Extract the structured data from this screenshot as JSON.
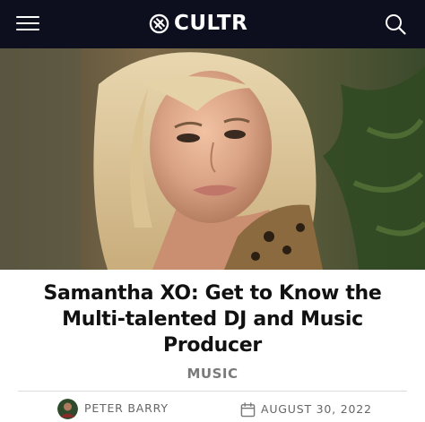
{
  "header": {
    "brand": "CULTR",
    "menu_icon": "hamburger-menu-icon",
    "brand_icon": "cultr-logo-icon",
    "search_icon": "search-icon",
    "background_color": "#0d0f1e"
  },
  "hero": {
    "image_description": "Portrait photo of a blonde woman"
  },
  "article": {
    "title": "Samantha XO: Get to Know the Multi-talented DJ and Music Producer",
    "category": "MUSIC",
    "author": "PETER BARRY",
    "date": "AUGUST 30, 2022",
    "date_icon": "calendar-icon"
  }
}
